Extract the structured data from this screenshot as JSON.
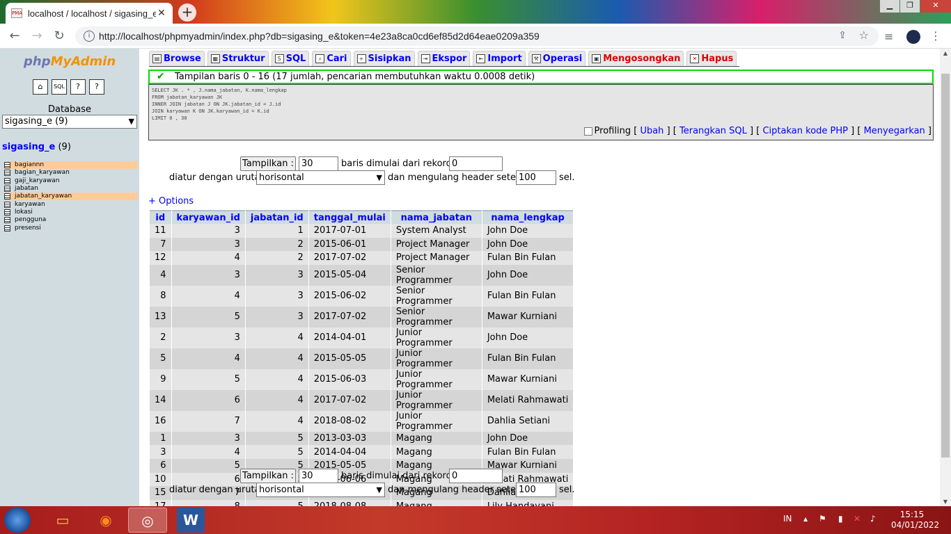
{
  "browser": {
    "tab_title": "localhost / localhost / sigasing_e",
    "tab_favicon": "PMA",
    "close_glyph": "✕",
    "new_tab_glyph": "+",
    "url": "http://localhost/phpmyadmin/index.php?db=sigasing_e&token=4e23a8ca0cd6ef85d2d64eae0209a359",
    "back_glyph": "←",
    "forward_glyph": "→",
    "reload_glyph": "↻",
    "info_glyph": "i",
    "share_glyph": "⇪",
    "star_glyph": "☆",
    "media_glyph": "≡",
    "menu_glyph": "⋮",
    "win_minimize": "▁",
    "win_restore": "❐",
    "win_close": "✕"
  },
  "sidebar": {
    "logo_php": "php",
    "logo_myadmin": "MyAdmin",
    "icons": [
      "home-icon",
      "sql-icon",
      "help-icon",
      "docs-icon"
    ],
    "icon_glyphs": [
      "⌂",
      "SQL",
      "?",
      "?"
    ],
    "database_label": "Database",
    "database_select": "sigasing_e (9)",
    "select_arrow": "▼",
    "db_name": "sigasing_e",
    "db_count": "(9)",
    "tables": [
      {
        "name": "bagiannn",
        "highlight": true
      },
      {
        "name": "bagian_karyawan",
        "highlight": false
      },
      {
        "name": "gaji_karyawan",
        "highlight": false
      },
      {
        "name": "jabatan",
        "highlight": false
      },
      {
        "name": "jabatan_karyawan",
        "highlight": true
      },
      {
        "name": "karyawan",
        "highlight": false
      },
      {
        "name": "lokasi",
        "highlight": false
      },
      {
        "name": "pengguna",
        "highlight": false
      },
      {
        "name": "presensi",
        "highlight": false
      }
    ]
  },
  "main": {
    "tabs": [
      {
        "label": "Browse",
        "icon": "browse-icon",
        "glyph": "▤"
      },
      {
        "label": "Struktur",
        "icon": "structure-icon",
        "glyph": "▦"
      },
      {
        "label": "SQL",
        "icon": "sql-icon",
        "glyph": "S"
      },
      {
        "label": "Cari",
        "icon": "search-icon",
        "glyph": "⌕"
      },
      {
        "label": "Sisipkan",
        "icon": "insert-icon",
        "glyph": "+"
      },
      {
        "label": "Ekspor",
        "icon": "export-icon",
        "glyph": "⇥"
      },
      {
        "label": "Import",
        "icon": "import-icon",
        "glyph": "⇤"
      },
      {
        "label": "Operasi",
        "icon": "operations-icon",
        "glyph": "⚒"
      },
      {
        "label": "Mengosongkan",
        "icon": "empty-icon",
        "glyph": "▣"
      },
      {
        "label": "Hapus",
        "icon": "drop-icon",
        "glyph": "✕"
      }
    ],
    "success_message": "Tampilan baris 0 - 16 (17 jumlah, pencarian membutuhkan waktu 0.0008 detik)",
    "check_glyph": "✔",
    "sql_lines": [
      "SELECT JK . * , J.nama_jabatan, K.nama_lengkap",
      "FROM jabatan_karyawan JK",
      "INNER JOIN jabatan J ON JK.jabatan_id = J.id",
      "JOIN karyawan K ON JK.karyawan_id = K.id",
      "LIMIT 0 , 30"
    ],
    "sql_links": {
      "profiling": "Profiling",
      "ubah": "Ubah",
      "terangkan": "Terangkan SQL",
      "ciptakan": "Ciptakan kode PHP",
      "menyegarkan": "Menyegarkan",
      "open_bracket": "[",
      "close_bracket": "]"
    },
    "nav": {
      "show_button": "Tampilkan :",
      "rows_value": "30",
      "rows_text": "baris dimulai dari rekord #",
      "start_value": "0",
      "order_text": "diatur dengan urutan",
      "order_value": "horisontal",
      "repeat_text": "dan mengulang header setelah",
      "repeat_value": "100",
      "cells_text": "sel."
    },
    "options_link": "+ Options",
    "columns": [
      "id",
      "karyawan_id",
      "jabatan_id",
      "tanggal_mulai",
      "nama_jabatan",
      "nama_lengkap"
    ],
    "rows": [
      [
        "11",
        "3",
        "1",
        "2017-07-01",
        "System Analyst",
        "John Doe"
      ],
      [
        "7",
        "3",
        "2",
        "2015-06-01",
        "Project Manager",
        "John Doe"
      ],
      [
        "12",
        "4",
        "2",
        "2017-07-02",
        "Project Manager",
        "Fulan Bin Fulan"
      ],
      [
        "4",
        "3",
        "3",
        "2015-05-04",
        "Senior Programmer",
        "John Doe"
      ],
      [
        "8",
        "4",
        "3",
        "2015-06-02",
        "Senior Programmer",
        "Fulan Bin Fulan"
      ],
      [
        "13",
        "5",
        "3",
        "2017-07-02",
        "Senior Programmer",
        "Mawar Kurniani"
      ],
      [
        "2",
        "3",
        "4",
        "2014-04-01",
        "Junior Programmer",
        "John Doe"
      ],
      [
        "5",
        "4",
        "4",
        "2015-05-05",
        "Junior Programmer",
        "Fulan Bin Fulan"
      ],
      [
        "9",
        "5",
        "4",
        "2015-06-03",
        "Junior Programmer",
        "Mawar Kurniani"
      ],
      [
        "14",
        "6",
        "4",
        "2017-07-02",
        "Junior Programmer",
        "Melati Rahmawati"
      ],
      [
        "16",
        "7",
        "4",
        "2018-08-02",
        "Junior Programmer",
        "Dahlia Setiani"
      ],
      [
        "1",
        "3",
        "5",
        "2013-03-03",
        "Magang",
        "John Doe"
      ],
      [
        "3",
        "4",
        "5",
        "2014-04-04",
        "Magang",
        "Fulan Bin Fulan"
      ],
      [
        "6",
        "5",
        "5",
        "2015-05-05",
        "Magang",
        "Mawar Kurniani"
      ],
      [
        "10",
        "6",
        "5",
        "2015-06-06",
        "Magang",
        "Melati Rahmawati"
      ],
      [
        "15",
        "7",
        "5",
        "2017-07-07",
        "Magang",
        "Dahlia Setiani"
      ],
      [
        "17",
        "8",
        "5",
        "2018-08-08",
        "Magang",
        "Lily Handayani"
      ]
    ]
  },
  "taskbar": {
    "apps": [
      "file-explorer-icon",
      "firefox-icon",
      "chrome-icon",
      "word-icon"
    ],
    "app_glyphs": [
      "▭",
      "◉",
      "◎",
      "W"
    ],
    "language": "IN",
    "tray_glyphs": [
      "▲",
      "⚑",
      "▮",
      "✕",
      "♪"
    ],
    "time": "15:15",
    "date": "04/01/2022"
  },
  "scrollbar": {
    "up_glyph": "▲",
    "down_glyph": "▼"
  }
}
